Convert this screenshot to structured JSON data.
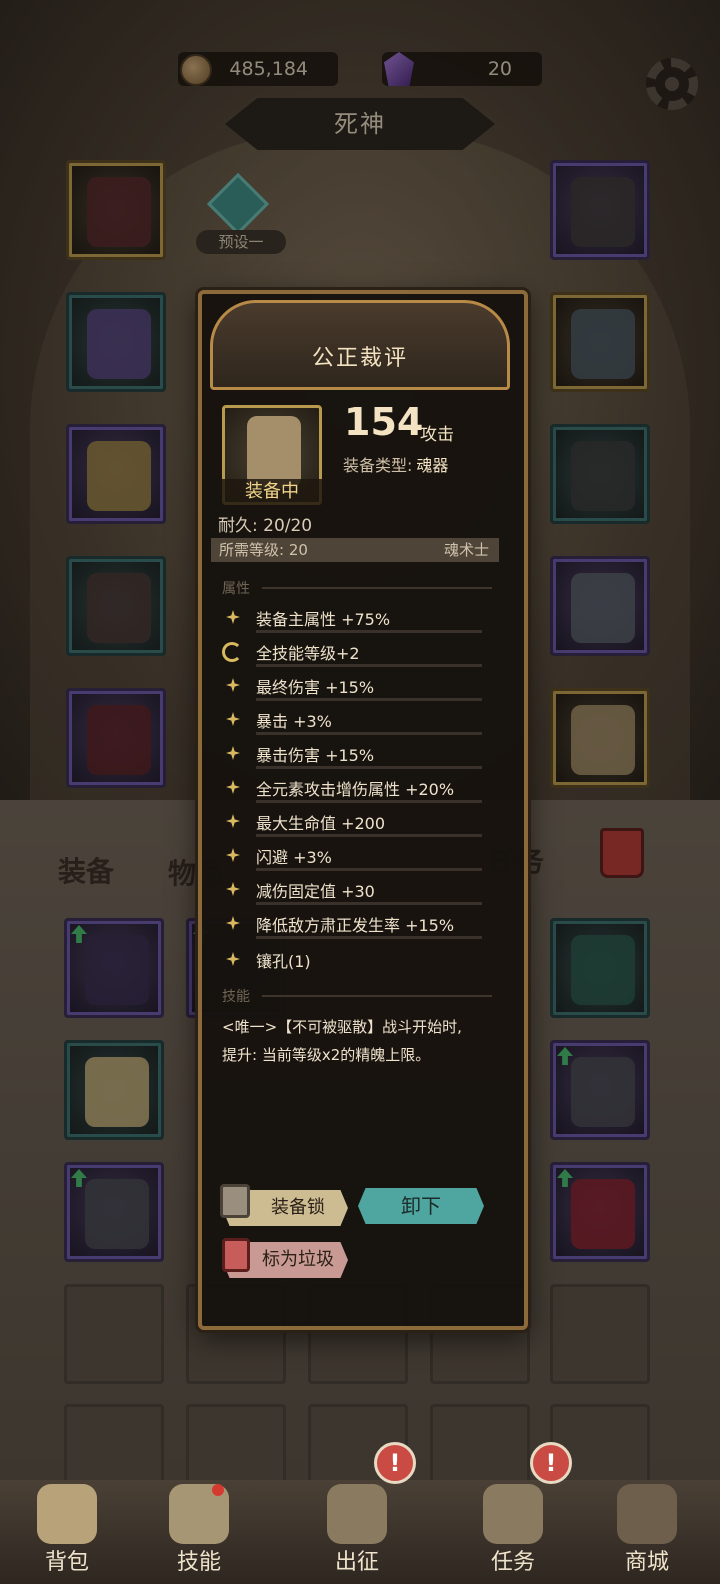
{
  "currency": {
    "coins": "485,184",
    "gems": "20"
  },
  "character": {
    "name": "死神"
  },
  "preset": {
    "label": "预设一"
  },
  "tabs": {
    "equip": "装备",
    "items": "物品",
    "tasks_partial": "任务"
  },
  "popup": {
    "title": "公正裁评",
    "equipped_tag": "装备中",
    "power_value": "154",
    "power_unit": "攻击",
    "type_label": "装备类型:",
    "type_value": "魂器",
    "durability": "耐久: 20/20",
    "required_level": "所需等级: 20",
    "class_name": "魂术士",
    "attr_section": "属性",
    "attributes": [
      "装备主属性 +75%",
      "全技能等级+2",
      "最终伤害 +15%",
      "暴击 +3%",
      "暴击伤害 +15%",
      "全元素攻击增伤属性 +20%",
      "最大生命值 +200",
      "闪避 +3%",
      "减伤固定值 +30",
      "降低敌方肃正发生率 +15%",
      "镶孔(1)"
    ],
    "skill_section": "技能",
    "skill_line1": "<唯一>【不可被驱散】战斗开始时,",
    "skill_line2": "提升: 当前等级x2的精魄上限。",
    "buttons": {
      "lock": "装备锁",
      "unequip": "卸下",
      "trash": "标为垃圾"
    }
  },
  "bottom_nav": [
    "背包",
    "技能",
    "出征",
    "任务",
    "商城"
  ],
  "badge_mark": "!",
  "colors": {
    "accent_gold": "#b89a4f",
    "accent_teal": "#4fa59f",
    "rare_purple": "#6b58a6"
  }
}
